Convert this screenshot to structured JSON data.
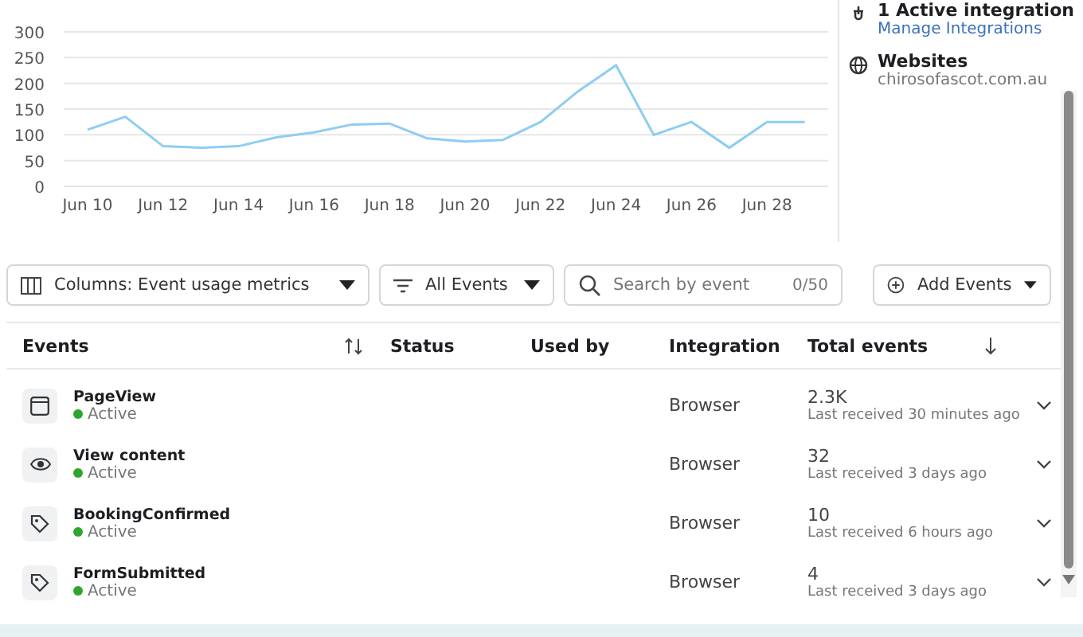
{
  "chart_data": {
    "type": "line",
    "categories": [
      "Jun 10",
      null,
      "Jun 12",
      null,
      "Jun 14",
      null,
      "Jun 16",
      null,
      "Jun 18",
      null,
      "Jun 20",
      null,
      "Jun 22",
      null,
      "Jun 24",
      null,
      "Jun 26",
      null,
      "Jun 28",
      null
    ],
    "series": [
      {
        "color": "#8ecdf2",
        "values": [
          110,
          135,
          78,
          75,
          78,
          95,
          105,
          120,
          122,
          93,
          87,
          90,
          125,
          185,
          235,
          100,
          125,
          75,
          125,
          125
        ]
      }
    ],
    "grid": true,
    "ylim": [
      0,
      300
    ],
    "yticks": [
      0,
      50,
      100,
      150,
      200,
      250,
      300
    ]
  },
  "side_panel": {
    "integration_count": "1 Active integration",
    "manage_link": "Manage Integrations",
    "websites_title": "Websites",
    "website": "chirosofascot.com.au"
  },
  "toolbar": {
    "columns_select": "Columns: Event usage metrics",
    "filter_select": "All Events",
    "search": {
      "placeholder": "Search by event",
      "counter": "0/50"
    },
    "add_button": "Add Events"
  },
  "table": {
    "columns": [
      "Events",
      "Status",
      "Used by",
      "Integration",
      "Total events"
    ],
    "rows": [
      {
        "kind": "window",
        "name": "PageView",
        "status": "Active",
        "integration": "Browser",
        "total": "2.3K",
        "last_received": "Last received 30 minutes ago"
      },
      {
        "kind": "eye",
        "name": "View content",
        "status": "Active",
        "integration": "Browser",
        "total": "32",
        "last_received": "Last received 3 days ago"
      },
      {
        "kind": "tag",
        "name": "BookingConfirmed",
        "status": "Active",
        "integration": "Browser",
        "total": "10",
        "last_received": "Last received 6 hours ago"
      },
      {
        "kind": "tag",
        "name": "FormSubmitted",
        "status": "Active",
        "integration": "Browser",
        "total": "4",
        "last_received": "Last received 3 days ago"
      }
    ]
  }
}
